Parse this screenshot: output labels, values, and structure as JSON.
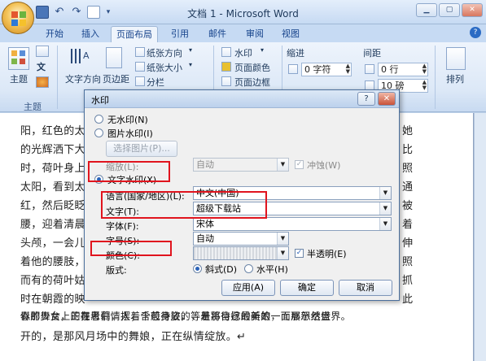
{
  "window": {
    "title": "文档 1 - Microsoft Word",
    "controls": [
      "minimize",
      "maximize",
      "close"
    ]
  },
  "tabs": [
    {
      "label": "开始",
      "active": false
    },
    {
      "label": "插入",
      "active": false
    },
    {
      "label": "页面布局",
      "active": true
    },
    {
      "label": "引用",
      "active": false
    },
    {
      "label": "邮件",
      "active": false
    },
    {
      "label": "审阅",
      "active": false
    },
    {
      "label": "视图",
      "active": false
    }
  ],
  "ribbon": {
    "theme": {
      "big_label": "主题",
      "group_label": "主题",
      "small_label": "文"
    },
    "page_setup": {
      "text_direction": "文字方向",
      "margins": "页边距",
      "orientation": "纸张方向",
      "size": "纸张大小",
      "columns": "分栏"
    },
    "page_background": {
      "watermark": "水印",
      "page_color": "页面颜色",
      "page_borders": "页面边框"
    },
    "paragraph": {
      "indent_label": "缩进",
      "spacing_label": "间距",
      "indent_left_value": "0 字符",
      "spacing_before_value": "0 行",
      "spacing_after_value": "10 磅"
    },
    "arrange": {
      "label": "排列"
    }
  },
  "document": {
    "lines": [
      "阳，红色的太",
      "的光辉洒下大",
      "时，荷叶身上",
      "太阳，看到太",
      "红，然后眨眨",
      "腰，迎着清晨",
      "头颅，一会儿",
      "着他的腰肢，",
      "而有的荷叶姑",
      "时在朝霞的映",
      "似那舞台上的舞者们，摆着千般身姿，等着将自己最美的一面展示给世界。",
      "春的少女，正在思慕情人；含苞待放的，是那待嫁的新娘，而那怒然盛",
      "开的，是那风月场中的舞娘，正在纵情绽放。↵"
    ],
    "right_fragments": [
      "她",
      "比",
      "照",
      "通",
      "被",
      "着",
      "伸",
      "照",
      "抓",
      "此"
    ]
  },
  "dialog": {
    "title": "水印",
    "help": "?",
    "close": "✕",
    "no_watermark": "无水印(N)",
    "picture_watermark": "图片水印(I)",
    "select_picture": "选择图片(P)...",
    "scale_label": "缩放(L):",
    "scale_value": "自动",
    "washout": "冲蚀(W)",
    "text_watermark": "文字水印(X)",
    "language_label": "语言(国家/地区)(L):",
    "language_value": "中文(中国)",
    "text_label": "文字(T):",
    "text_value": "超级下载站",
    "font_label": "字体(F):",
    "font_value": "宋体",
    "size_label": "字号(S):",
    "size_value": "自动",
    "color_label": "颜色(C):",
    "semitransparent": "半透明(E)",
    "layout_label": "版式:",
    "diagonal": "斜式(D)",
    "horizontal": "水平(H)",
    "apply": "应用(A)",
    "ok": "确定",
    "cancel": "取消",
    "highlight_color": "#e0141e"
  }
}
